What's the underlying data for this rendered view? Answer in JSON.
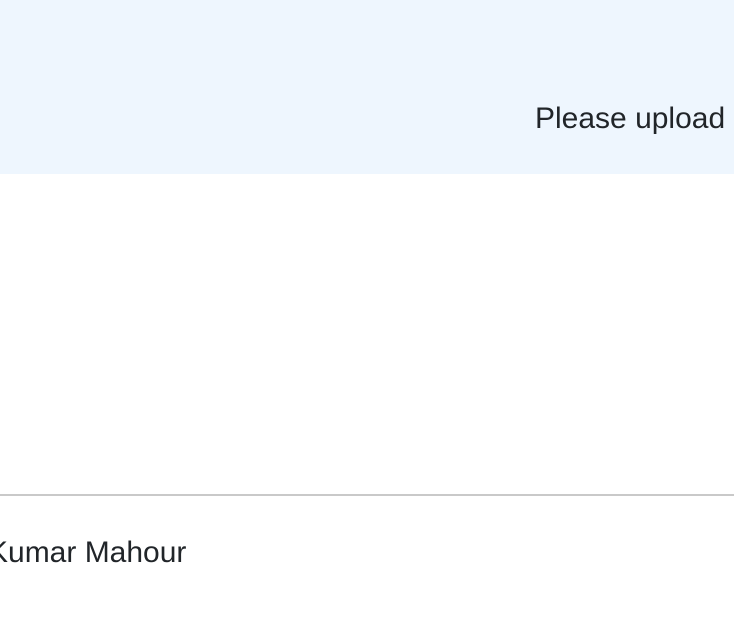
{
  "banner": {
    "message": "Please upload"
  },
  "footer": {
    "author_name": "Kumar Mahour"
  }
}
